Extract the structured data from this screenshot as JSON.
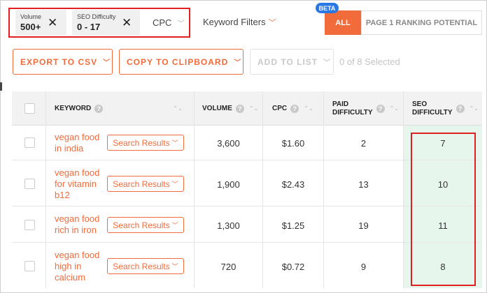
{
  "filters": {
    "volume": {
      "label": "Volume",
      "value": "500+",
      "remove": "✕"
    },
    "seo_difficulty": {
      "label": "SEO Difficulty",
      "value": "0 - 17",
      "remove": "✕"
    },
    "cpc": {
      "label": "CPC",
      "chevron": "﹀"
    },
    "keyword_filters": {
      "label": "Keyword Filters",
      "chevron": "﹀"
    }
  },
  "toggle": {
    "beta": "BETA",
    "all": "ALL",
    "page1": "PAGE 1 RANKING POTENTIAL"
  },
  "actions": {
    "export": "EXPORT TO CSV",
    "copy": "COPY TO CLIPBOARD",
    "add": "ADD TO LIST",
    "chevron": "﹀",
    "selected": "0 of 8 Selected"
  },
  "table": {
    "headers": {
      "keyword": "KEYWORD",
      "volume": "VOLUME",
      "cpc": "CPC",
      "paid_line1": "PAID",
      "paid_line2": "DIFFICULTY",
      "seo_line1": "SEO",
      "seo_line2": "DIFFICULTY",
      "help": "?",
      "sort": "⌃⌄"
    },
    "search_results_label": "Search Results",
    "chevron": "﹀",
    "rows": [
      {
        "keyword": [
          "vegan food",
          "in india"
        ],
        "volume": "3,600",
        "cpc": "$1.60",
        "paid": "2",
        "seo": "7"
      },
      {
        "keyword": [
          "vegan food",
          "for vitamin",
          "b12"
        ],
        "volume": "1,900",
        "cpc": "$2.43",
        "paid": "13",
        "seo": "10"
      },
      {
        "keyword": [
          "vegan food",
          "rich in iron"
        ],
        "volume": "1,300",
        "cpc": "$1.25",
        "paid": "19",
        "seo": "11"
      },
      {
        "keyword": [
          "vegan food",
          "high in",
          "calcium"
        ],
        "volume": "720",
        "cpc": "$0.72",
        "paid": "9",
        "seo": "8"
      }
    ]
  },
  "colors": {
    "accent": "#f26b3a",
    "highlight": "#e02020",
    "beta": "#2a78e4",
    "seo_column": "#e6f6ec"
  }
}
